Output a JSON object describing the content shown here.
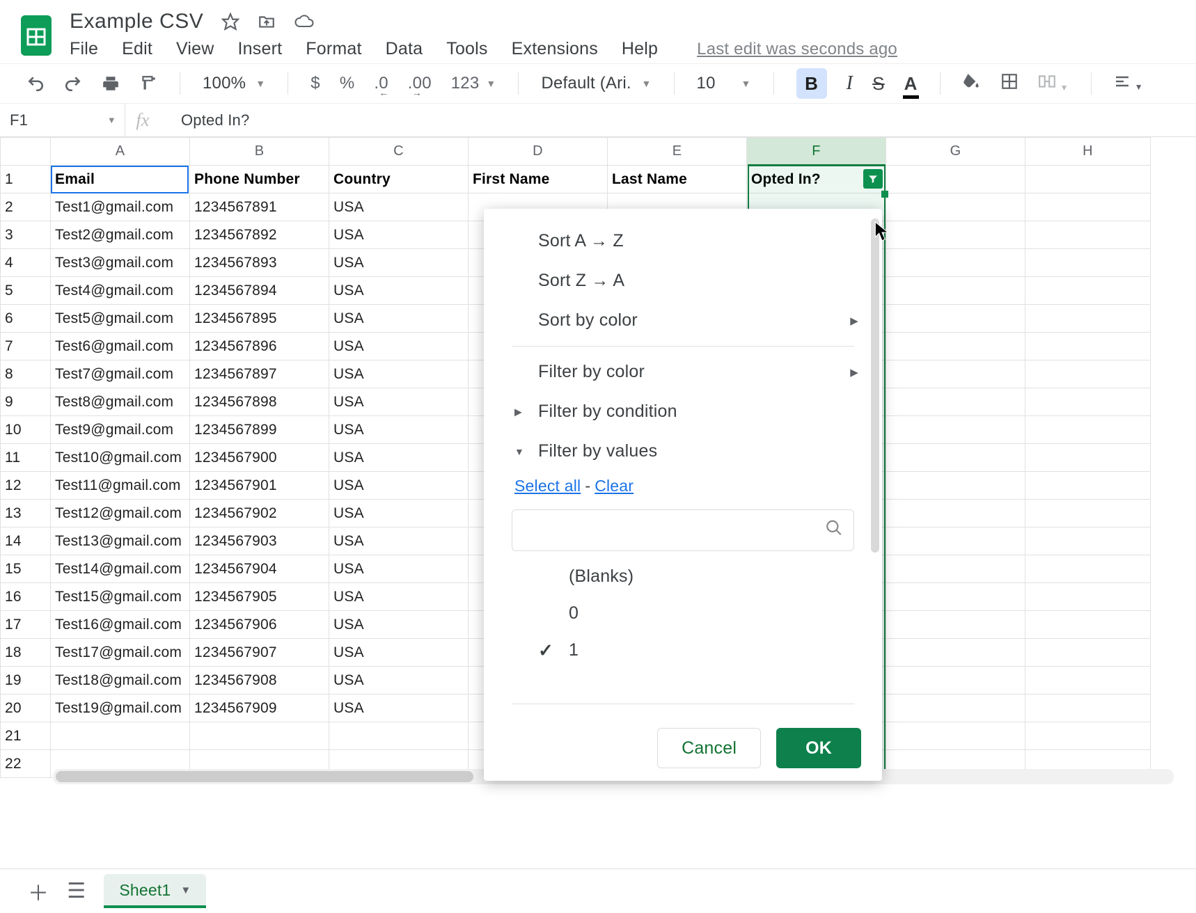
{
  "doc": {
    "title": "Example CSV",
    "last_edit": "Last edit was seconds ago"
  },
  "menu": {
    "file": "File",
    "edit": "Edit",
    "view": "View",
    "insert": "Insert",
    "format": "Format",
    "data": "Data",
    "tools": "Tools",
    "extensions": "Extensions",
    "help": "Help"
  },
  "toolbar": {
    "zoom": "100%",
    "currency": "$",
    "percent": "%",
    "dec_dec": ".0",
    "dec_inc": ".00",
    "numfmt": "123",
    "font": "Default (Ari...",
    "font_size": "10",
    "bold": "B",
    "italic": "I",
    "strike": "S",
    "textcolor": "A"
  },
  "fx": {
    "namebox": "F1",
    "formula": "Opted In?"
  },
  "columns": {
    "A": "A",
    "B": "B",
    "C": "C",
    "D": "D",
    "E": "E",
    "F": "F",
    "G": "G",
    "H": "H"
  },
  "headers": {
    "A": "Email",
    "B": "Phone Number",
    "C": "Country",
    "D": "First Name",
    "E": "Last Name",
    "F": "Opted In?"
  },
  "rows": [
    {
      "n": "1"
    },
    {
      "n": "2",
      "A": "Test1@gmail.com",
      "B": "1234567891",
      "C": "USA"
    },
    {
      "n": "3",
      "A": "Test2@gmail.com",
      "B": "1234567892",
      "C": "USA"
    },
    {
      "n": "4",
      "A": "Test3@gmail.com",
      "B": "1234567893",
      "C": "USA"
    },
    {
      "n": "5",
      "A": "Test4@gmail.com",
      "B": "1234567894",
      "C": "USA"
    },
    {
      "n": "6",
      "A": "Test5@gmail.com",
      "B": "1234567895",
      "C": "USA"
    },
    {
      "n": "7",
      "A": "Test6@gmail.com",
      "B": "1234567896",
      "C": "USA"
    },
    {
      "n": "8",
      "A": "Test7@gmail.com",
      "B": "1234567897",
      "C": "USA"
    },
    {
      "n": "9",
      "A": "Test8@gmail.com",
      "B": "1234567898",
      "C": "USA"
    },
    {
      "n": "10",
      "A": "Test9@gmail.com",
      "B": "1234567899",
      "C": "USA"
    },
    {
      "n": "11",
      "A": "Test10@gmail.com",
      "B": "1234567900",
      "C": "USA"
    },
    {
      "n": "12",
      "A": "Test11@gmail.com",
      "B": "1234567901",
      "C": "USA"
    },
    {
      "n": "13",
      "A": "Test12@gmail.com",
      "B": "1234567902",
      "C": "USA"
    },
    {
      "n": "14",
      "A": "Test13@gmail.com",
      "B": "1234567903",
      "C": "USA"
    },
    {
      "n": "15",
      "A": "Test14@gmail.com",
      "B": "1234567904",
      "C": "USA"
    },
    {
      "n": "16",
      "A": "Test15@gmail.com",
      "B": "1234567905",
      "C": "USA"
    },
    {
      "n": "17",
      "A": "Test16@gmail.com",
      "B": "1234567906",
      "C": "USA"
    },
    {
      "n": "18",
      "A": "Test17@gmail.com",
      "B": "1234567907",
      "C": "USA"
    },
    {
      "n": "19",
      "A": "Test18@gmail.com",
      "B": "1234567908",
      "C": "USA"
    },
    {
      "n": "20",
      "A": "Test19@gmail.com",
      "B": "1234567909",
      "C": "USA"
    },
    {
      "n": "21"
    },
    {
      "n": "22"
    }
  ],
  "filter": {
    "sort_az": "Sort A → Z",
    "sort_za": "Sort Z → A",
    "sort_color": "Sort by color",
    "filter_color": "Filter by color",
    "filter_cond": "Filter by condition",
    "filter_vals": "Filter by values",
    "select_all": "Select all",
    "clear": "Clear",
    "search_placeholder": "",
    "val_blanks": "(Blanks)",
    "val_0": "0",
    "val_1": "1",
    "cancel": "Cancel",
    "ok": "OK"
  },
  "sheets": {
    "tab1": "Sheet1"
  }
}
